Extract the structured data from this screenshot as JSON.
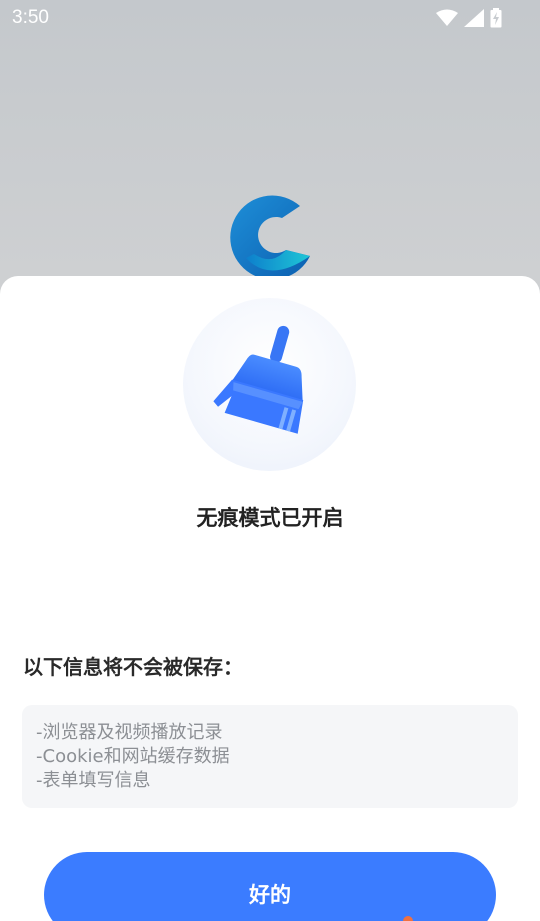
{
  "status_bar": {
    "time": "3:50",
    "icons": [
      "wifi-icon",
      "cell-signal-icon",
      "battery-charging-icon"
    ]
  },
  "background": {
    "logo": "app-logo-c"
  },
  "dialog": {
    "icon": "broom-icon",
    "title": "无痕模式已开启",
    "subheading": "以下信息将不会被保存：",
    "items": [
      "-浏览器及视频播放记录",
      "-Cookie和网站缓存数据",
      "-表单填写信息"
    ],
    "ok_label": "好的"
  },
  "colors": {
    "accent": "#3b7cff",
    "text_primary": "#222222",
    "text_secondary": "#8c8f94",
    "info_bg": "#f5f6f8"
  }
}
